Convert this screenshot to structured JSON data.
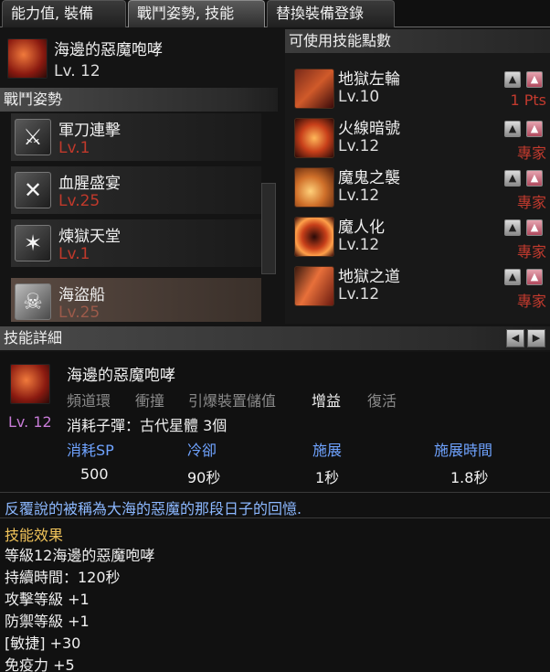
{
  "tabs": [
    {
      "label": "能力值, 裝備"
    },
    {
      "label": "戰鬥姿勢, 技能"
    },
    {
      "label": "替換裝備登錄"
    }
  ],
  "current_skill": {
    "name": "海邊的惡魔咆哮",
    "level": "Lv. 12",
    "icon": "demon-roar-icon"
  },
  "stance_section": {
    "title": "戰鬥姿勢",
    "items": [
      {
        "name": "軍刀連擊",
        "level": "Lv.1",
        "icon": "saber-combo-icon"
      },
      {
        "name": "血腥盛宴",
        "level": "Lv.25",
        "icon": "blood-feast-icon"
      },
      {
        "name": "煉獄天堂",
        "level": "Lv.1",
        "icon": "purgatory-icon"
      },
      {
        "name": "海盜船",
        "level": "Lv.25",
        "icon": "pirate-ship-icon"
      }
    ]
  },
  "abilities_section": {
    "title": "可使用技能點數",
    "items": [
      {
        "name": "地獄左輪",
        "level": "Lv.10",
        "right_text": "1 Pts",
        "icon": "hell-revolver-icon"
      },
      {
        "name": "火線暗號",
        "level": "Lv.12",
        "right_text": "專家",
        "icon": "fireline-signal-icon"
      },
      {
        "name": "魔鬼之襲",
        "level": "Lv.12",
        "right_text": "專家",
        "icon": "devil-strike-icon"
      },
      {
        "name": "魔人化",
        "level": "Lv.12",
        "right_text": "專家",
        "icon": "demonize-icon"
      },
      {
        "name": "地獄之道",
        "level": "Lv.12",
        "right_text": "專家",
        "icon": "hell-path-icon"
      }
    ]
  },
  "detail": {
    "title": "技能詳細",
    "skill_name": "海邊的惡魔咆哮",
    "tags": [
      {
        "label": "頻道環",
        "active": false
      },
      {
        "label": "衝撞",
        "active": false
      },
      {
        "label": "引爆裝置儲值",
        "active": false
      },
      {
        "label": "增益",
        "active": true
      },
      {
        "label": "復活",
        "active": false
      }
    ],
    "level": "Lv. 12",
    "consume": "消耗子彈：古代星體 3個",
    "stats": [
      {
        "label": "消耗SP",
        "value": "500"
      },
      {
        "label": "冷卻",
        "value": "90秒"
      },
      {
        "label": "施展",
        "value": "1秒"
      },
      {
        "label": "施展時間",
        "value": "1.8秒"
      }
    ],
    "description": "反覆說的被稱為大海的惡魔的那段日子的回憶.",
    "effect_title": "技能效果",
    "effects": [
      "等級12海邊的惡魔咆哮",
      "持續時間：120秒",
      "攻擊等級 +1",
      "防禦等級 +1",
      "[敏捷] +30",
      "免疫力 +5"
    ]
  },
  "colors": {
    "accent_blue": "#6fa3ff",
    "accent_gold": "#f0c35a",
    "level_red": "#c0392b",
    "text_white": "#f0f0f0"
  }
}
